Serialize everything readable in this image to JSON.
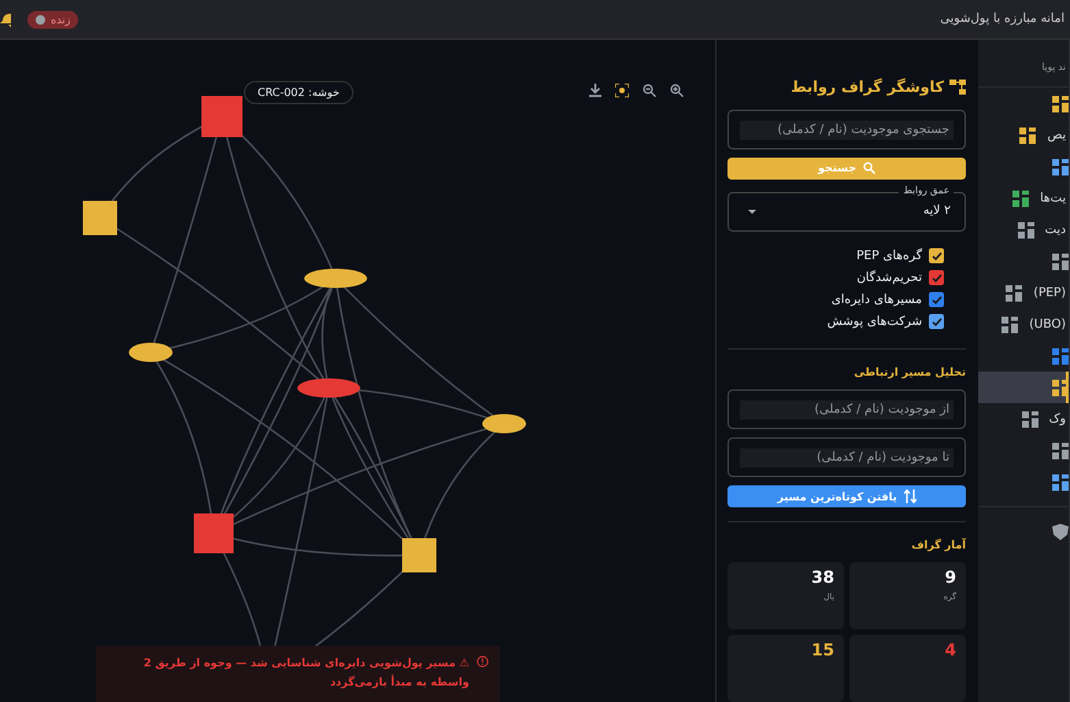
{
  "topbar": {
    "title": "امانه مبارزه با پول‌شویی",
    "live_badge": "زنده"
  },
  "graph": {
    "cluster_badge": "خوشه: CRC-002",
    "alert": "⚠ مسیر پول‌شویی دایره‌ای شناسایی شد — وجوه از طریق 2 واسطه به مبدأ بازمی‌گردد"
  },
  "panel": {
    "title": "کاوشگر گراف روابط",
    "search": {
      "placeholder": "جستجوی موجودیت (نام / کدملی)"
    },
    "search_button": "جستجو",
    "depth": {
      "label": "عمق روابط",
      "value": "۲ لایه"
    },
    "filters": [
      {
        "label": "گره‌های PEP",
        "checked": true,
        "color": "#e6b43c"
      },
      {
        "label": "تحریم‌شدگان",
        "checked": true,
        "color": "#e53935"
      },
      {
        "label": "مسیرهای دایره‌ای",
        "checked": true,
        "color": "#2f80ed"
      },
      {
        "label": "شرکت‌های پوشش",
        "checked": true,
        "color": "#5aa0f0"
      }
    ],
    "path_title": "تحلیل مسیر ارتباطی",
    "from": {
      "placeholder": "از موجودیت (نام / کدملی)"
    },
    "to": {
      "placeholder": "تا موجودیت (نام / کدملی)"
    },
    "path_button": "یافتن کوتاه‌ترین مسیر",
    "stats_title": "آمار گراف",
    "stats": [
      {
        "value": "9",
        "label": "گره",
        "color": "#ffffff"
      },
      {
        "value": "38",
        "label": "یال",
        "color": "#ffffff"
      },
      {
        "value": "4",
        "color": "#e53935"
      },
      {
        "value": "15",
        "color": "#e6b43c"
      }
    ]
  },
  "sidebar": {
    "header": "ند پویا",
    "items": [
      {
        "selected": false
      },
      {
        "label": "یص",
        "selected": false
      },
      {
        "selected": false
      },
      {
        "label": "یت‌ها",
        "selected": false
      },
      {
        "label": "دیت",
        "selected": false
      },
      {
        "selected": false
      },
      {
        "label": "(PEP)",
        "selected": false
      },
      {
        "label": "(UBO)",
        "selected": false
      },
      {
        "selected": false
      },
      {
        "selected": true
      },
      {
        "label": "وک",
        "selected": false
      },
      {
        "selected": false
      },
      {
        "selected": false
      }
    ],
    "footer_items": [
      {
        "selected": false
      }
    ]
  }
}
